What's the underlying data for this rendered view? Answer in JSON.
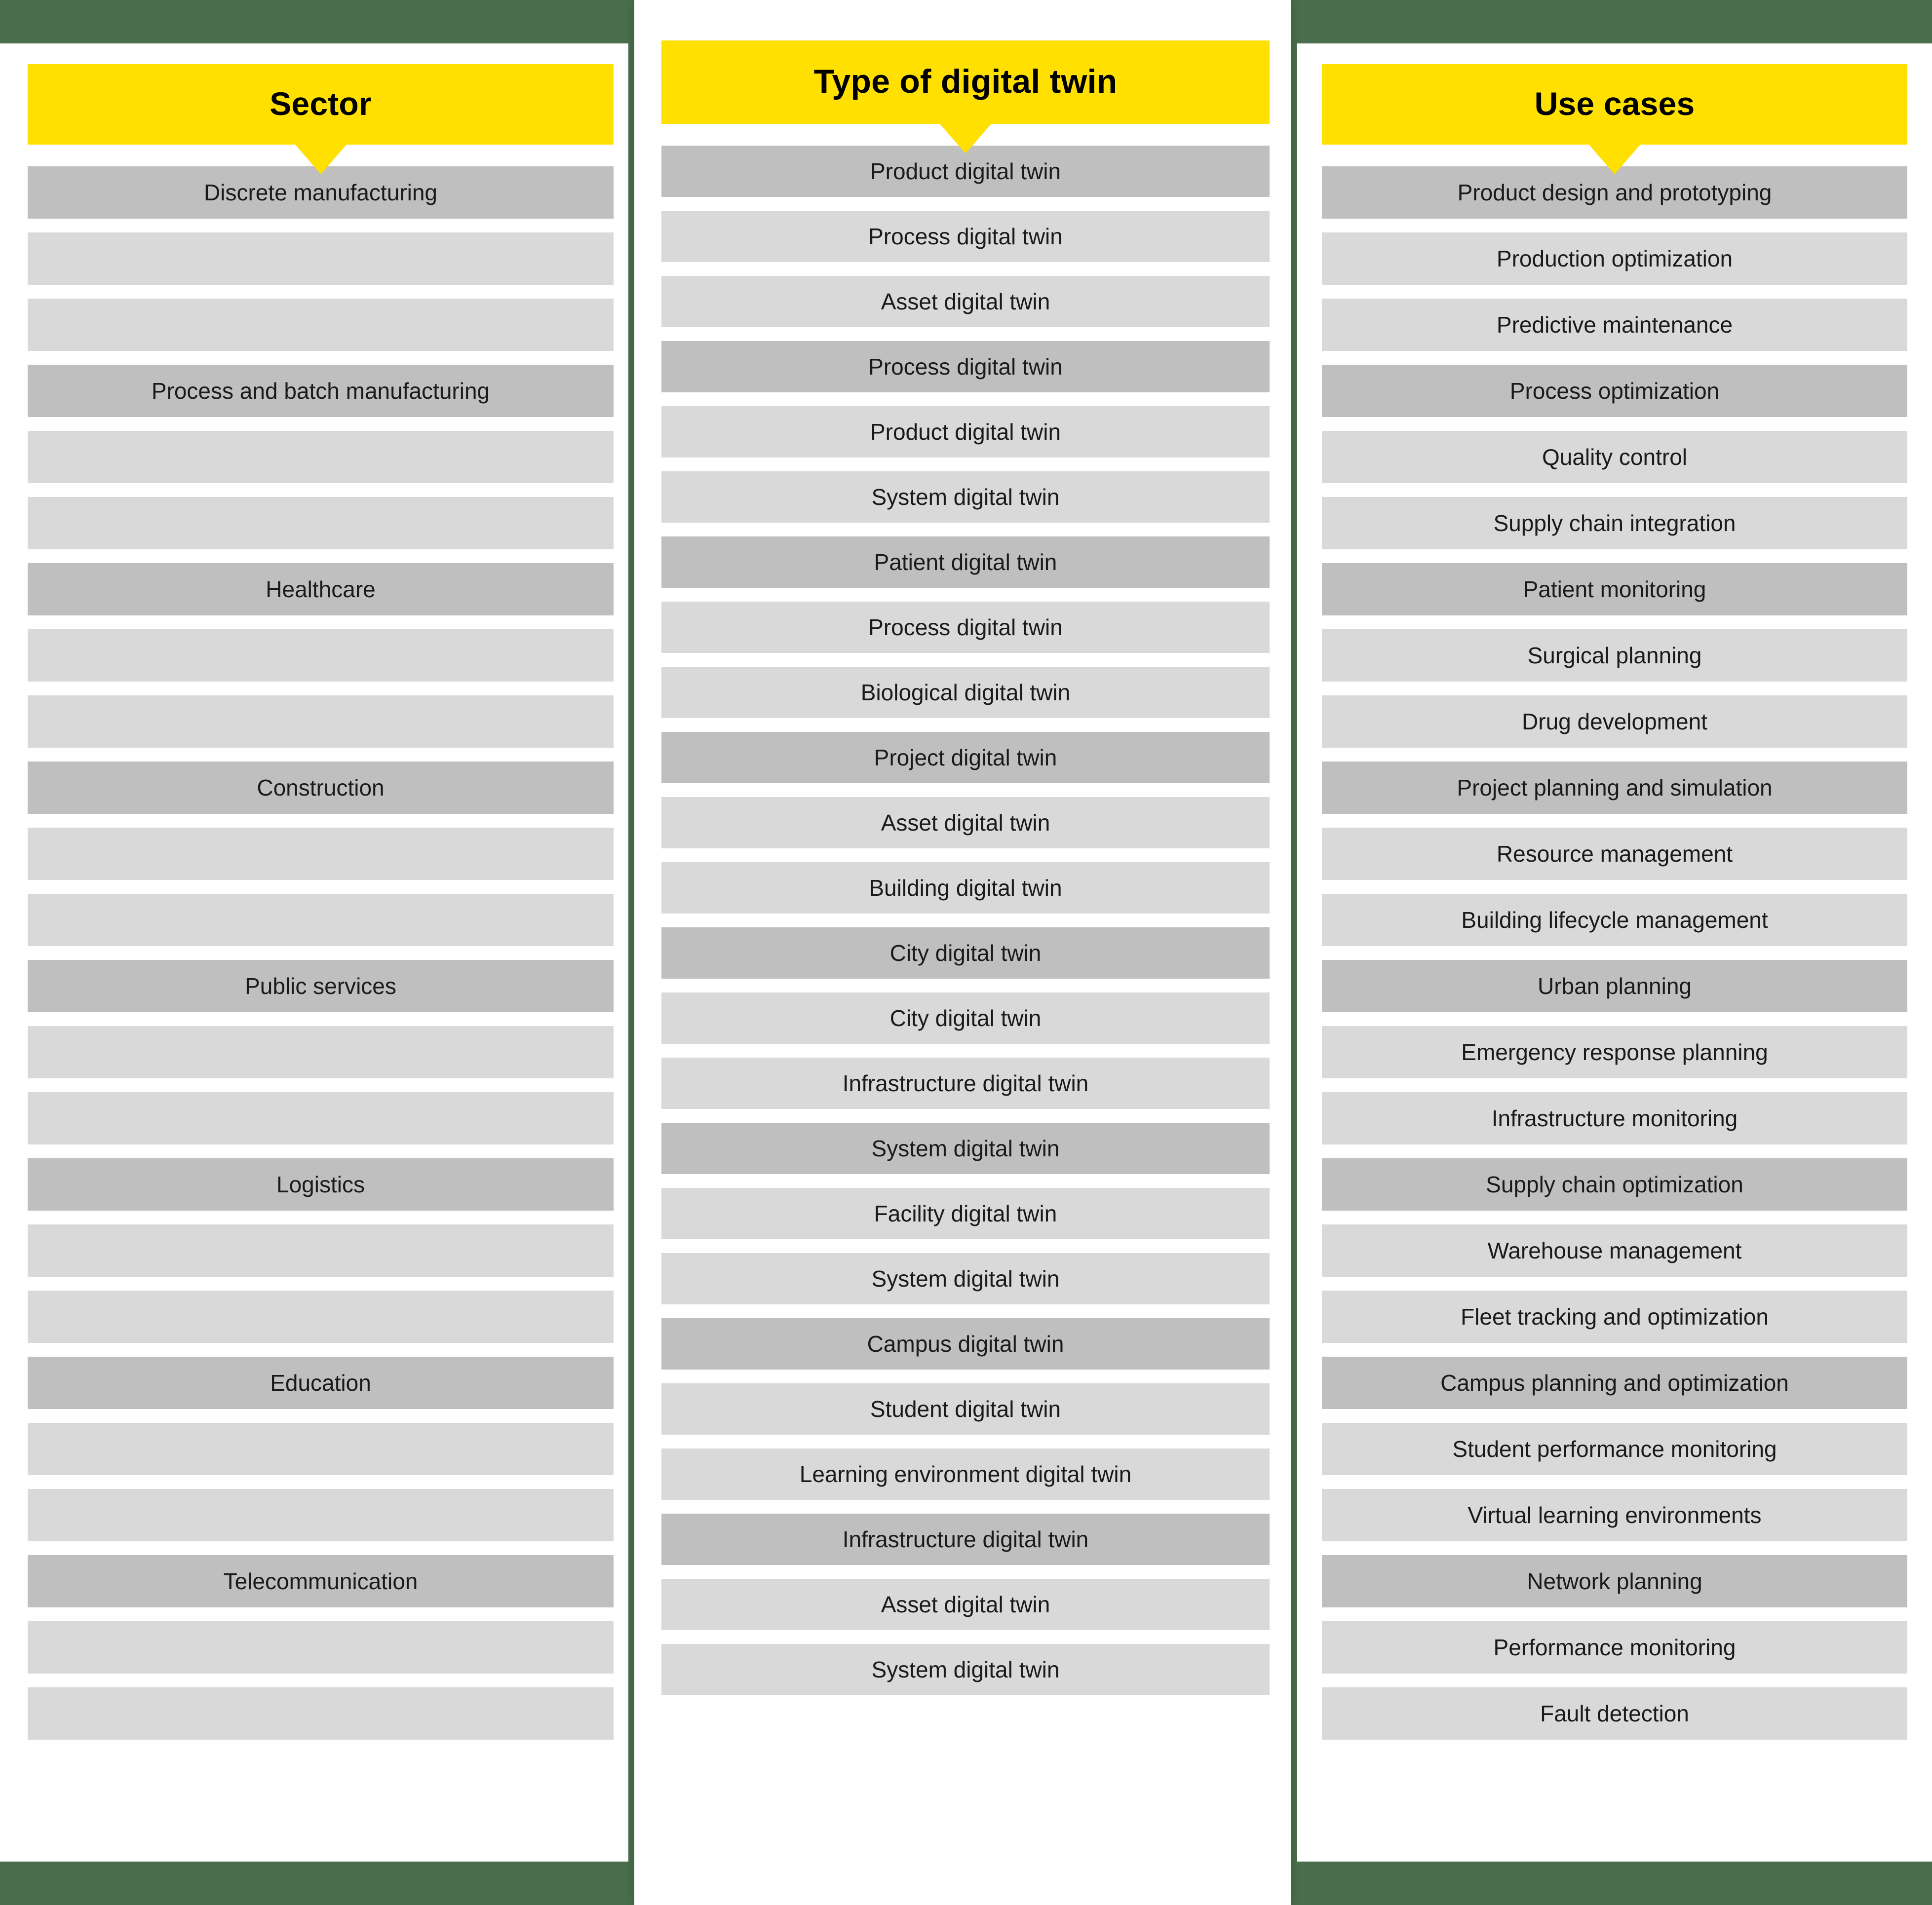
{
  "colors": {
    "background_green": "#4a6e4c",
    "header_yellow": "#ffe000",
    "row_dark": "#bfbfbf",
    "row_light": "#d9d9d9",
    "card_white": "#ffffff",
    "text": "#000000"
  },
  "columns": {
    "sector": {
      "header": "Sector",
      "rows": [
        {
          "label": "Discrete manufacturing",
          "dark": true
        },
        {
          "label": "",
          "dark": false
        },
        {
          "label": "",
          "dark": false
        },
        {
          "label": "Process and batch manufacturing",
          "dark": true
        },
        {
          "label": "",
          "dark": false
        },
        {
          "label": "",
          "dark": false
        },
        {
          "label": "Healthcare",
          "dark": true
        },
        {
          "label": "",
          "dark": false
        },
        {
          "label": "",
          "dark": false
        },
        {
          "label": "Construction",
          "dark": true
        },
        {
          "label": "",
          "dark": false
        },
        {
          "label": "",
          "dark": false
        },
        {
          "label": "Public services",
          "dark": true
        },
        {
          "label": "",
          "dark": false
        },
        {
          "label": "",
          "dark": false
        },
        {
          "label": "Logistics",
          "dark": true
        },
        {
          "label": "",
          "dark": false
        },
        {
          "label": "",
          "dark": false
        },
        {
          "label": "Education",
          "dark": true
        },
        {
          "label": "",
          "dark": false
        },
        {
          "label": "",
          "dark": false
        },
        {
          "label": "Telecommunication",
          "dark": true
        },
        {
          "label": "",
          "dark": false
        },
        {
          "label": "",
          "dark": false
        }
      ]
    },
    "type_of_digital_twin": {
      "header": "Type of digital twin",
      "rows": [
        {
          "label": "Product digital twin",
          "dark": true
        },
        {
          "label": "Process digital twin",
          "dark": false
        },
        {
          "label": "Asset digital twin",
          "dark": false
        },
        {
          "label": "Process digital twin",
          "dark": true
        },
        {
          "label": "Product digital twin",
          "dark": false
        },
        {
          "label": "System digital twin",
          "dark": false
        },
        {
          "label": "Patient digital twin",
          "dark": true
        },
        {
          "label": "Process digital twin",
          "dark": false
        },
        {
          "label": "Biological digital twin",
          "dark": false
        },
        {
          "label": "Project digital twin",
          "dark": true
        },
        {
          "label": "Asset digital twin",
          "dark": false
        },
        {
          "label": "Building digital twin",
          "dark": false
        },
        {
          "label": "City digital twin",
          "dark": true
        },
        {
          "label": "City digital twin",
          "dark": false
        },
        {
          "label": "Infrastructure digital twin",
          "dark": false
        },
        {
          "label": "System digital twin",
          "dark": true
        },
        {
          "label": "Facility digital twin",
          "dark": false
        },
        {
          "label": "System digital twin",
          "dark": false
        },
        {
          "label": "Campus digital twin",
          "dark": true
        },
        {
          "label": "Student digital twin",
          "dark": false
        },
        {
          "label": "Learning environment digital twin",
          "dark": false
        },
        {
          "label": "Infrastructure digital twin",
          "dark": true
        },
        {
          "label": "Asset digital twin",
          "dark": false
        },
        {
          "label": "System digital twin",
          "dark": false
        }
      ]
    },
    "use_cases": {
      "header": "Use cases",
      "rows": [
        {
          "label": "Product design and prototyping",
          "dark": true
        },
        {
          "label": "Production optimization",
          "dark": false
        },
        {
          "label": "Predictive maintenance",
          "dark": false
        },
        {
          "label": "Process optimization",
          "dark": true
        },
        {
          "label": "Quality control",
          "dark": false
        },
        {
          "label": "Supply chain integration",
          "dark": false
        },
        {
          "label": "Patient monitoring",
          "dark": true
        },
        {
          "label": "Surgical planning",
          "dark": false
        },
        {
          "label": "Drug development",
          "dark": false
        },
        {
          "label": "Project planning and simulation",
          "dark": true
        },
        {
          "label": "Resource management",
          "dark": false
        },
        {
          "label": "Building lifecycle management",
          "dark": false
        },
        {
          "label": "Urban planning",
          "dark": true
        },
        {
          "label": "Emergency response planning",
          "dark": false
        },
        {
          "label": "Infrastructure monitoring",
          "dark": false
        },
        {
          "label": "Supply chain optimization",
          "dark": true
        },
        {
          "label": "Warehouse management",
          "dark": false
        },
        {
          "label": "Fleet tracking and optimization",
          "dark": false
        },
        {
          "label": "Campus planning and optimization",
          "dark": true
        },
        {
          "label": "Student performance monitoring",
          "dark": false
        },
        {
          "label": "Virtual learning environments",
          "dark": false
        },
        {
          "label": "Network planning",
          "dark": true
        },
        {
          "label": "Performance monitoring",
          "dark": false
        },
        {
          "label": "Fault detection",
          "dark": false
        }
      ]
    }
  }
}
